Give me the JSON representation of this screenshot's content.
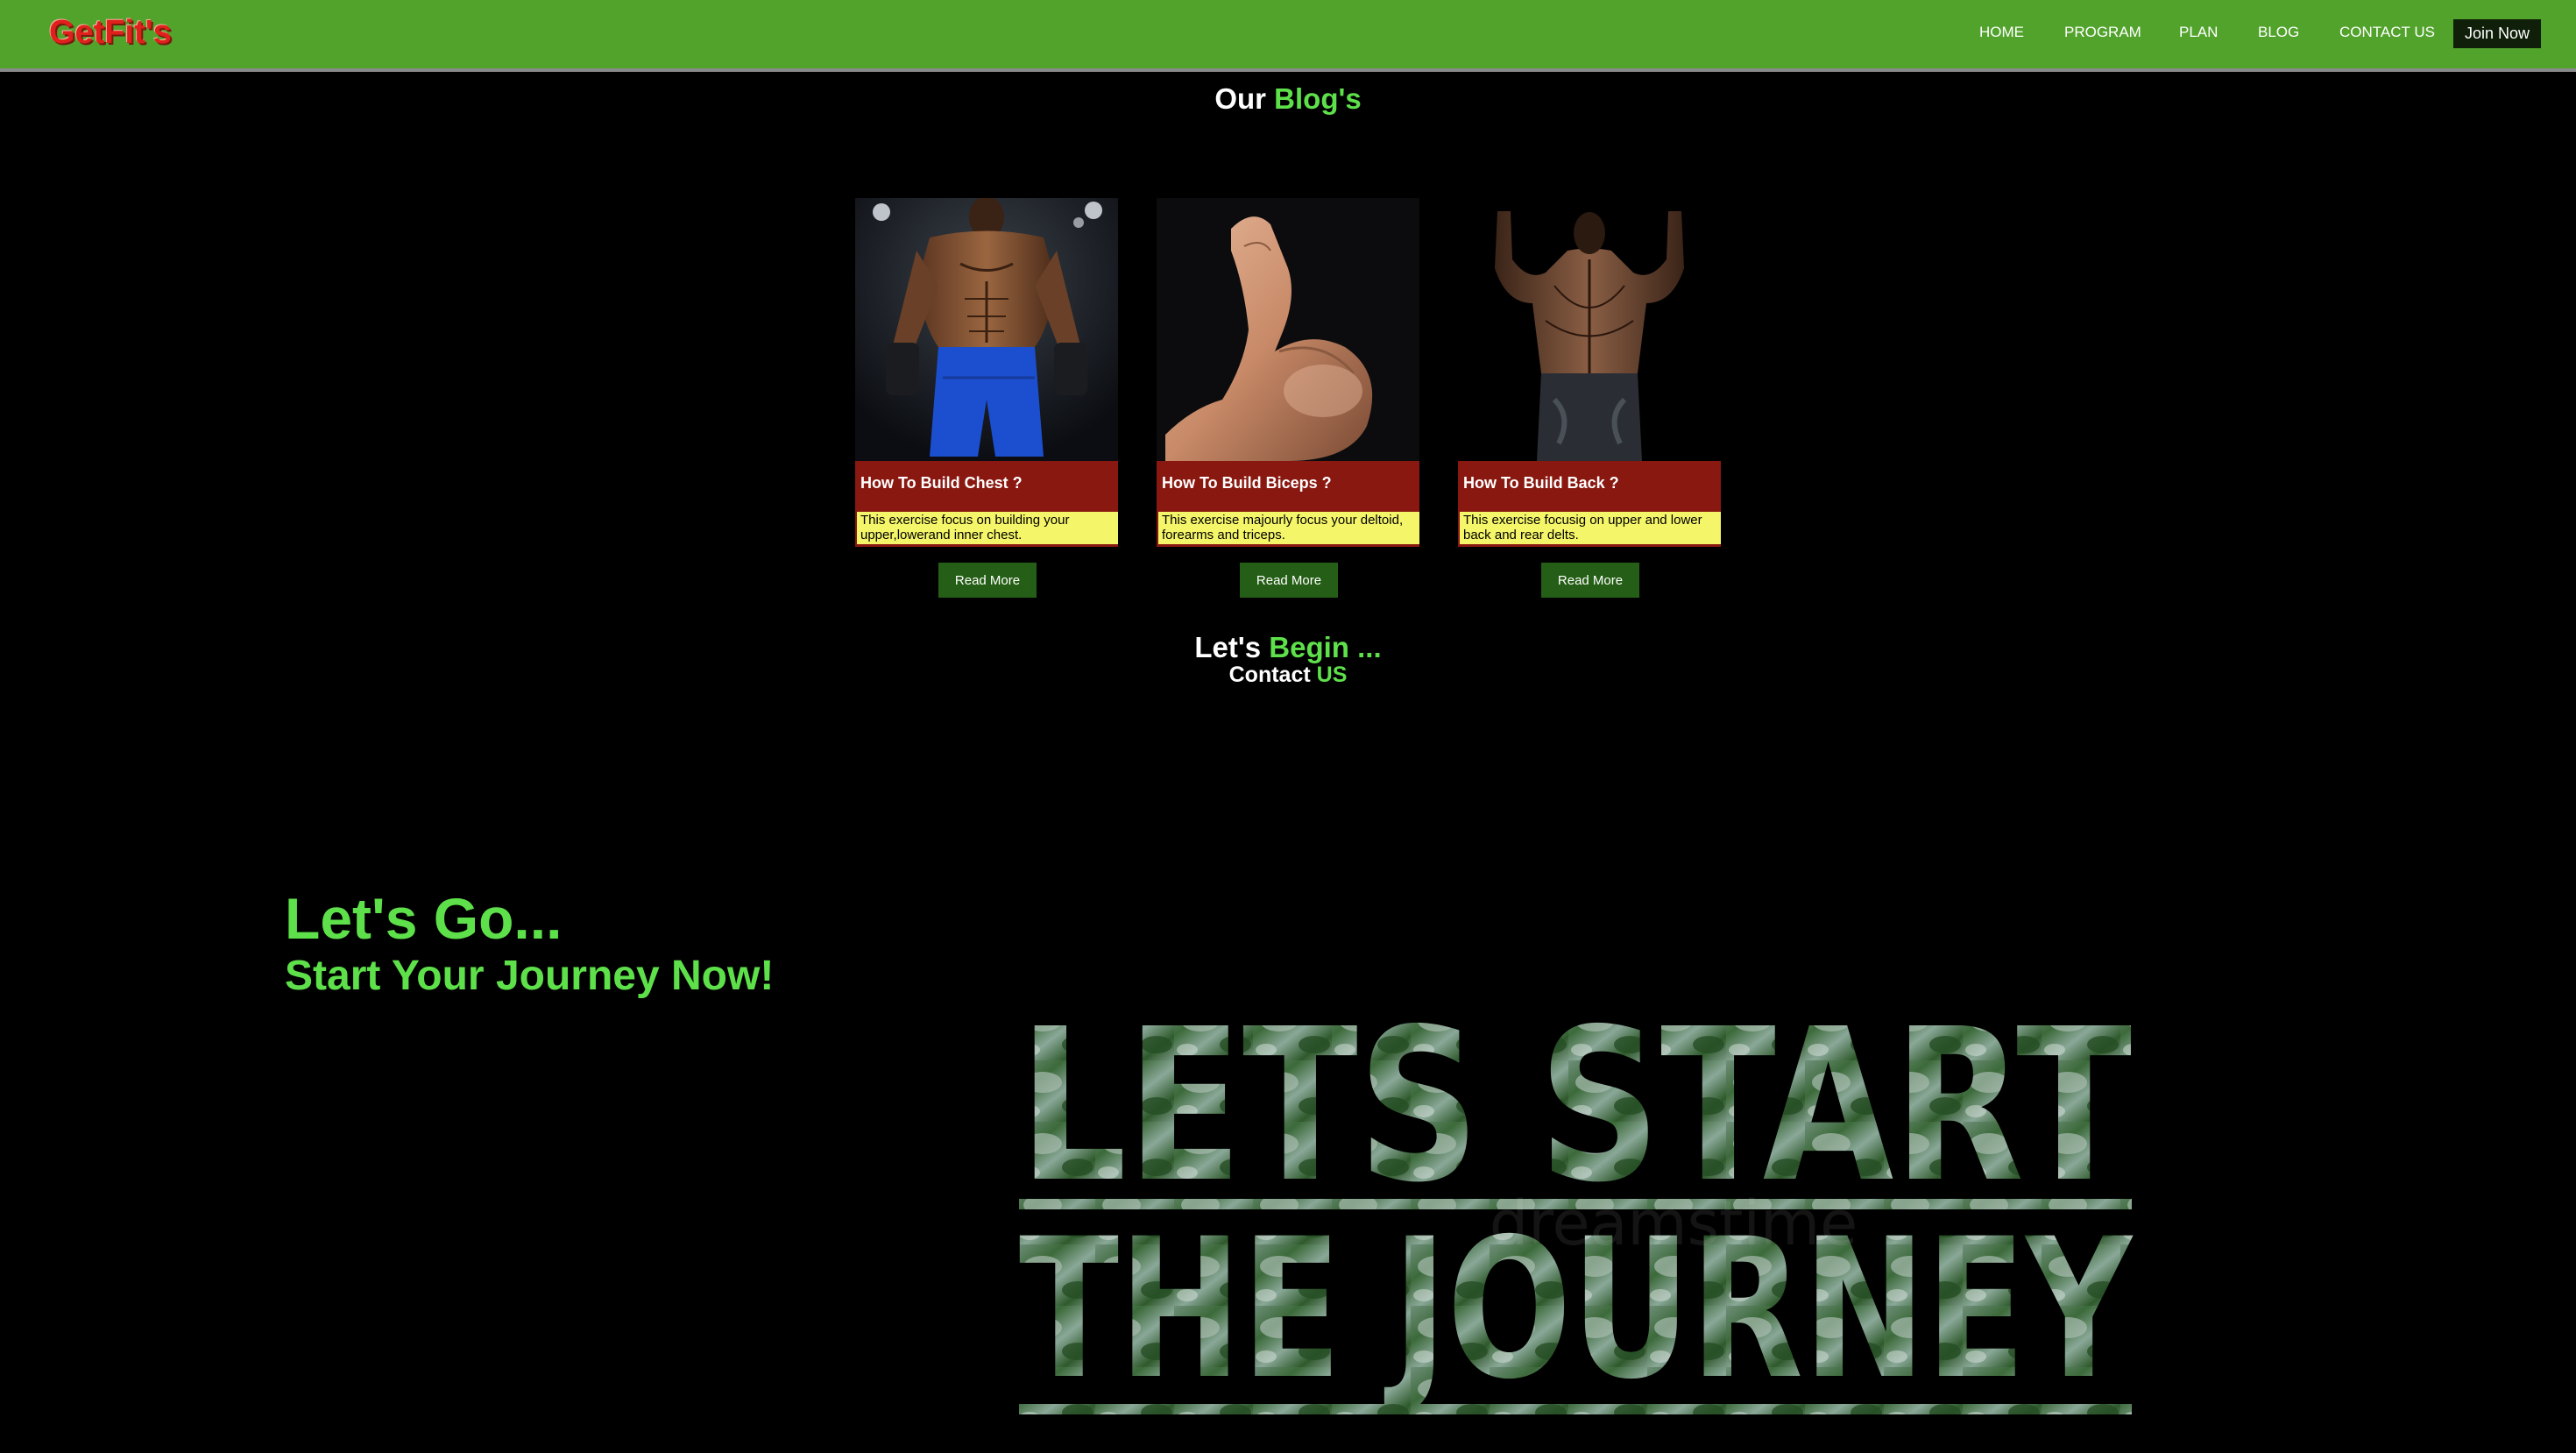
{
  "navbar": {
    "logo": "GetFit's",
    "links": [
      {
        "label": "HOME"
      },
      {
        "label": "PROGRAM"
      },
      {
        "label": "PLAN"
      },
      {
        "label": "BLOG"
      },
      {
        "label": "CONTACT US"
      }
    ],
    "join_label": "Join Now"
  },
  "blog": {
    "heading_white": "Our",
    "heading_green": "Blog's",
    "cards": [
      {
        "title": "How To Build Chest ?",
        "description": "This exercise focus on building your upper,lowerand inner chest.",
        "button": "Read More",
        "image_icon": "chest-workout-photo"
      },
      {
        "title": "How To Build Biceps ?",
        "description": "This exercise majourly focus your deltoid, forearms and triceps.",
        "button": "Read More",
        "image_icon": "biceps-flex-photo"
      },
      {
        "title": "How To Build Back ?",
        "description": "This exercise focusig on upper and lower back and rear delts.",
        "button": "Read More",
        "image_icon": "back-muscles-photo"
      }
    ]
  },
  "begin": {
    "heading_white": "Let's",
    "heading_green": "Begin ...",
    "contact_white": "Contact",
    "contact_green": "US"
  },
  "hero": {
    "line1": "Let's Go...",
    "line2": "Start Your Journey Now!",
    "image_line1": "LETS START",
    "image_line2": "THE JOURNEY",
    "watermark": "dreamstime"
  },
  "colors": {
    "nav_bg": "#52a32c",
    "accent_green": "#5ee04a",
    "card_title_bg": "#891810",
    "card_desc_bg": "#f5f56a",
    "button_bg": "#255e16",
    "logo_red": "#e0201a"
  }
}
